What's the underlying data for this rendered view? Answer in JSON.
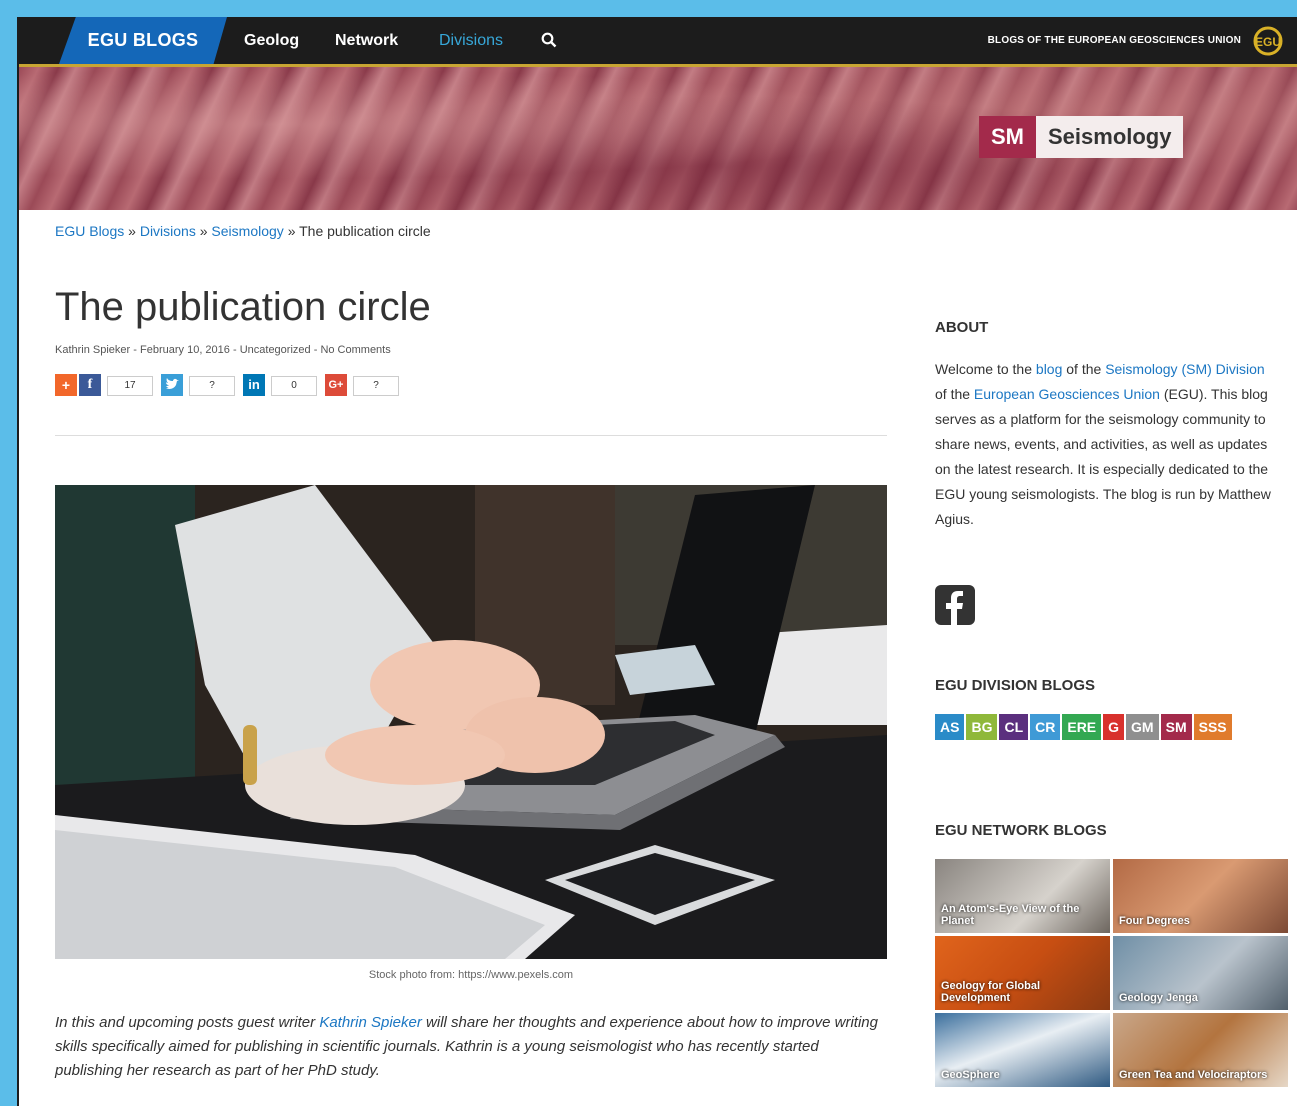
{
  "nav": {
    "brand": "EGU BLOGS",
    "items": [
      "Geolog",
      "Network",
      "Divisions"
    ],
    "tagline": "BLOGS OF THE EUROPEAN GEOSCIENCES UNION",
    "logo_text": "EGU"
  },
  "banner": {
    "abbr": "SM",
    "name": "Seismology"
  },
  "breadcrumb": {
    "items": [
      "EGU Blogs",
      "Divisions",
      "Seismology"
    ],
    "separator": "»",
    "current": "The publication circle"
  },
  "article": {
    "title": "The publication circle",
    "author": "Kathrin Spieker",
    "date": "February 10, 2016",
    "category": "Uncategorized",
    "comments": "No Comments",
    "meta_sep": "-",
    "share": {
      "facebook_count": "17",
      "twitter_count": "?",
      "linkedin_count": "0",
      "gplus_count": "?"
    },
    "caption": "Stock photo from: https://www.pexels.com",
    "intro_before": "In this and upcoming posts guest writer ",
    "intro_link": "Kathrin Spieker",
    "intro_after": " will share her thoughts and experience about how to improve writing skills specifically aimed for publishing in scientific journals. Kathrin is a young seismologist who has recently started publishing her research as part of her PhD study."
  },
  "sidebar": {
    "about_heading": "ABOUT",
    "about_p1": "Welcome to the ",
    "about_link1": "blog",
    "about_p2": " of the ",
    "about_link2": "Seismology (SM) Division",
    "about_p3": " of the ",
    "about_link3": "European Geosciences Union",
    "about_p4": " (EGU). This blog serves as a platform for the seismology community to share news, events, and activities, as well as updates on the latest research. It is especially dedicated to the EGU young seismologists. The blog is run by Matthew Agius.",
    "division_heading": "EGU DIVISION BLOGS",
    "divisions": [
      {
        "label": "AS",
        "color": "#2a8bc8"
      },
      {
        "label": "BG",
        "color": "#8fb83a"
      },
      {
        "label": "CL",
        "color": "#5b2f7e"
      },
      {
        "label": "CR",
        "color": "#3f9ad6"
      },
      {
        "label": "ERE",
        "color": "#33a852"
      },
      {
        "label": "G",
        "color": "#d8312c"
      },
      {
        "label": "GM",
        "color": "#8f8f8f"
      },
      {
        "label": "SM",
        "color": "#a32a4b"
      },
      {
        "label": "SSS",
        "color": "#e07b2c"
      }
    ],
    "network_heading": "EGU NETWORK BLOGS",
    "network": [
      "An Atom's-Eye View of the Planet",
      "Four Degrees",
      "Geology for Global Development",
      "Geology Jenga",
      "GeoSphere",
      "Green Tea and Velociraptors"
    ]
  }
}
